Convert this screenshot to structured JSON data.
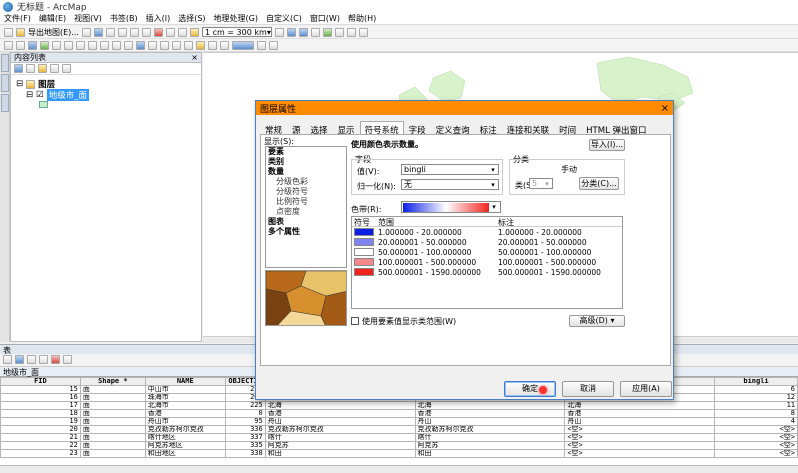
{
  "window": {
    "title": "无标题 - ArcMap"
  },
  "menus": [
    "文件(F)",
    "编辑(E)",
    "视图(V)",
    "书签(B)",
    "插入(I)",
    "选择(S)",
    "地理处理(G)",
    "自定义(C)",
    "窗口(W)",
    "帮助(H)"
  ],
  "toolbar": {
    "export_label": "导出地图(E)...",
    "scale_value": "1 cm = 300 km"
  },
  "toc": {
    "title": "内容列表",
    "layers_label": "图层",
    "layer_name": "地级市_面"
  },
  "dialog": {
    "title": "图层属性",
    "close_label": "×",
    "tabs": [
      "常规",
      "源",
      "选择",
      "显示",
      "符号系统",
      "字段",
      "定义查询",
      "标注",
      "连接和关联",
      "时间",
      "HTML 弹出窗口"
    ],
    "active_tab": "符号系统",
    "show_label": "显示(S):",
    "show_list": [
      {
        "text": "要素",
        "style": "bold"
      },
      {
        "text": "类别",
        "style": "bold"
      },
      {
        "text": "数量",
        "style": "bold"
      },
      {
        "text": "分级色彩",
        "style": "sub"
      },
      {
        "text": "分级符号",
        "style": "sub"
      },
      {
        "text": "比例符号",
        "style": "sub"
      },
      {
        "text": "点密度",
        "style": "sub"
      },
      {
        "text": "图表",
        "style": "bold"
      },
      {
        "text": "多个属性",
        "style": "bold"
      }
    ],
    "heading": "使用颜色表示数量。",
    "import_button": "导入(I)...",
    "fields_group": "字段",
    "value_label": "值(V):",
    "value_selected": "bingli",
    "normalize_label": "归一化(N):",
    "normalize_selected": "无",
    "classify_group": "分类",
    "classify_method": "手动",
    "classes_label": "类(S)",
    "classes_value": "5",
    "classify_button": "分类(C)...",
    "ramp_label": "色带(R):",
    "col_symbol": "符号",
    "col_range": "范围",
    "col_label": "标注",
    "classes": [
      {
        "color": "#0a1ee6",
        "range": "1.000000 - 20.000000",
        "label": "1.000000 - 20.000000"
      },
      {
        "color": "#7f83ef",
        "range": "20.000001 - 50.000000",
        "label": "20.000001 - 50.000000"
      },
      {
        "color": "#ffffff",
        "range": "50.000001 - 100.000000",
        "label": "50.000001 - 100.000000"
      },
      {
        "color": "#f3898a",
        "range": "100.000001 - 500.000000",
        "label": "100.000001 - 500.000000"
      },
      {
        "color": "#f0241f",
        "range": "500.000001 - 1590.000000",
        "label": "500.000001 - 1590.000000"
      }
    ],
    "feature_range_label": "使用要素值显示类范围(W)",
    "advanced_button": "高级(D)",
    "ok_button": "确定",
    "cancel_button": "取消",
    "apply_button": "应用(A)"
  },
  "table": {
    "panel_title": "表",
    "layer_tab": "地级市_面",
    "headers": [
      "FID",
      "Shape *",
      "NAME",
      "OBJECTID",
      "",
      "",
      "",
      "bingli"
    ],
    "rows": [
      [
        "15",
        "面",
        "中山市",
        "217",
        "",
        "",
        "",
        "6"
      ],
      [
        "16",
        "面",
        "珠海市",
        "203",
        "珠海",
        "珠海",
        "珠海",
        "12"
      ],
      [
        "17",
        "面",
        "北海市",
        "225",
        "北海",
        "北海",
        "北海",
        "11"
      ],
      [
        "18",
        "面",
        "香港",
        "0",
        "香港",
        "香港",
        "香港",
        "8"
      ],
      [
        "19",
        "面",
        "舟山市",
        "95",
        "舟山",
        "舟山",
        "舟山",
        "4"
      ],
      [
        "20",
        "面",
        "克孜勒苏柯尔克孜",
        "336",
        "克孜勒苏柯尔克孜",
        "克孜勒苏柯尔克孜",
        "<空>",
        "<空>"
      ],
      [
        "21",
        "面",
        "喀什地区",
        "337",
        "喀什",
        "喀什",
        "<空>",
        "<空>"
      ],
      [
        "22",
        "面",
        "阿克苏地区",
        "335",
        "阿克苏",
        "阿克苏",
        "<空>",
        "<空>"
      ],
      [
        "23",
        "面",
        "和田地区",
        "338",
        "和田",
        "和田",
        "<空>",
        "<空>"
      ]
    ]
  }
}
